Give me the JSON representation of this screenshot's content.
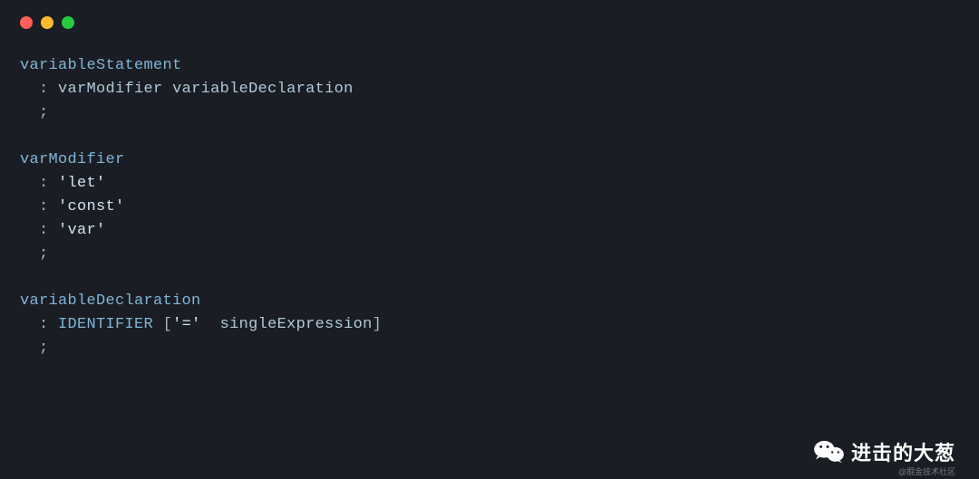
{
  "window": {
    "dots": [
      "red",
      "yellow",
      "green"
    ]
  },
  "code": {
    "lines": [
      {
        "parts": [
          {
            "t": "variableStatement",
            "c": "rule-name"
          }
        ]
      },
      {
        "parts": [
          {
            "t": "  ",
            "c": "punct"
          },
          {
            "t": ": ",
            "c": "punct"
          },
          {
            "t": "varModifier",
            "c": "ident"
          },
          {
            "t": " ",
            "c": "punct"
          },
          {
            "t": "variableDeclaration",
            "c": "ident"
          }
        ]
      },
      {
        "parts": [
          {
            "t": "  ",
            "c": "punct"
          },
          {
            "t": ";",
            "c": "punct"
          }
        ]
      },
      {
        "parts": []
      },
      {
        "parts": [
          {
            "t": "varModifier",
            "c": "rule-name"
          }
        ]
      },
      {
        "parts": [
          {
            "t": "  ",
            "c": "punct"
          },
          {
            "t": ": ",
            "c": "punct"
          },
          {
            "t": "'let'",
            "c": "string"
          }
        ]
      },
      {
        "parts": [
          {
            "t": "  ",
            "c": "punct"
          },
          {
            "t": ": ",
            "c": "punct"
          },
          {
            "t": "'const'",
            "c": "string"
          }
        ]
      },
      {
        "parts": [
          {
            "t": "  ",
            "c": "punct"
          },
          {
            "t": ": ",
            "c": "punct"
          },
          {
            "t": "'var'",
            "c": "string"
          }
        ]
      },
      {
        "parts": [
          {
            "t": "  ",
            "c": "punct"
          },
          {
            "t": ";",
            "c": "punct"
          }
        ]
      },
      {
        "parts": []
      },
      {
        "parts": [
          {
            "t": "variableDeclaration",
            "c": "rule-name"
          }
        ]
      },
      {
        "parts": [
          {
            "t": "  ",
            "c": "punct"
          },
          {
            "t": ": ",
            "c": "punct"
          },
          {
            "t": "IDENTIFIER",
            "c": "kw"
          },
          {
            "t": " [",
            "c": "punct"
          },
          {
            "t": "'='",
            "c": "string"
          },
          {
            "t": "  ",
            "c": "punct"
          },
          {
            "t": "singleExpression",
            "c": "ident"
          },
          {
            "t": "]",
            "c": "punct"
          }
        ]
      },
      {
        "parts": [
          {
            "t": "  ",
            "c": "punct"
          },
          {
            "t": ";",
            "c": "punct"
          }
        ]
      }
    ]
  },
  "watermark": {
    "text": "进击的大葱",
    "sub": "@掘金技术社区"
  }
}
